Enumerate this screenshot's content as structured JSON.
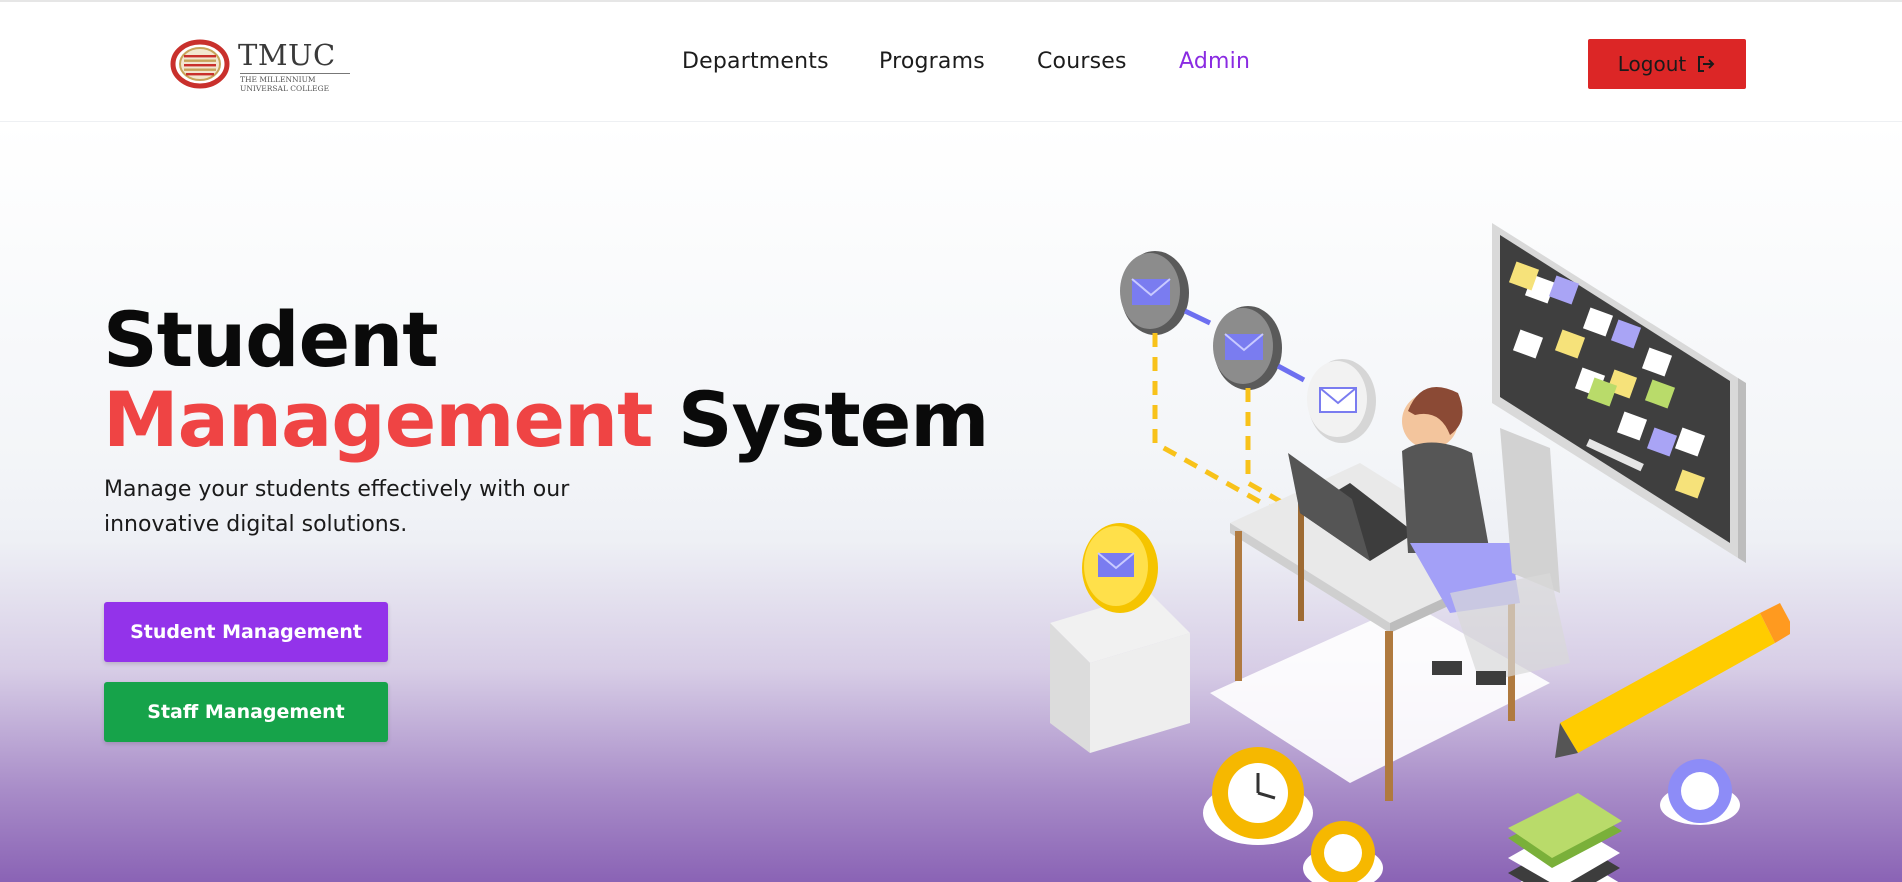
{
  "header": {
    "logo": {
      "name": "TMUC",
      "subtitle_line1": "The Millennium",
      "subtitle_line2": "Universal College"
    },
    "nav": [
      {
        "label": "Departments",
        "active": false
      },
      {
        "label": "Programs",
        "active": false
      },
      {
        "label": "Courses",
        "active": false
      },
      {
        "label": "Admin",
        "active": true
      }
    ],
    "logout_label": "Logout"
  },
  "hero": {
    "title_line1": "Student",
    "title_accent": "Management",
    "title_rest": "System",
    "description": "Manage your students effectively with our innovative digital solutions.",
    "buttons": {
      "student": "Student Management",
      "staff": "Staff Management"
    }
  },
  "colors": {
    "accent_red": "#ef4444",
    "logout_red": "#dc2626",
    "purple": "#9333ea",
    "green": "#16a34a",
    "active_nav": "#8a2be2"
  },
  "icons": [
    "tmuc-logo-icon",
    "logout-icon",
    "workspace-illustration"
  ]
}
